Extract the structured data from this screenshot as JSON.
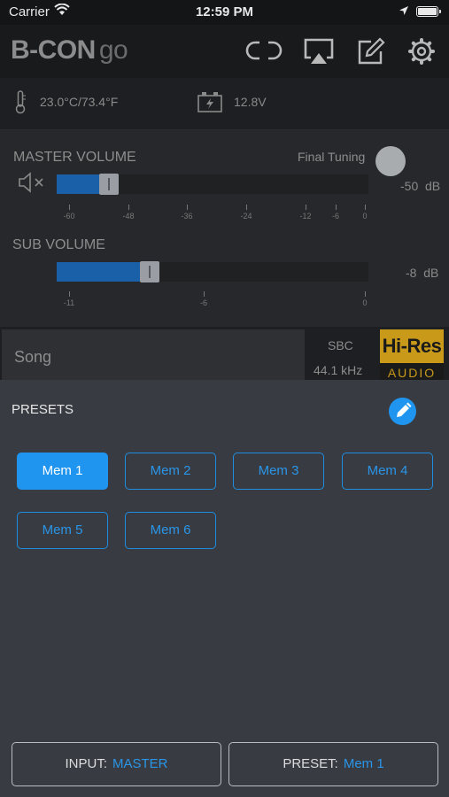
{
  "status_bar": {
    "carrier": "Carrier",
    "time": "12:59 PM"
  },
  "header": {
    "logo_main": "B-CON",
    "logo_sub": "go",
    "icons": [
      "link-icon",
      "airplay-icon",
      "edit-icon",
      "settings-gear-icon"
    ]
  },
  "info": {
    "temperature": "23.0°C/73.4°F",
    "voltage": "12.8V"
  },
  "master_volume": {
    "label": "MASTER VOLUME",
    "final_tuning_label": "Final Tuning",
    "value_db": "-50",
    "unit": "dB",
    "level": 0.2,
    "ticks": [
      "-60",
      "-48",
      "-36",
      "-24",
      "-12",
      "-6",
      "0"
    ]
  },
  "sub_volume": {
    "label": "SUB VOLUME",
    "value_db": "-8",
    "unit": "dB",
    "level": 0.33,
    "ticks": [
      "-11",
      "-6",
      "0"
    ]
  },
  "now_playing": {
    "song": "Song",
    "codec": "SBC",
    "sample_rate": "44.1 kHz",
    "badge_top": "Hi-Res",
    "badge_bottom": "AUDIO"
  },
  "presets": {
    "title": "PRESETS",
    "items": [
      {
        "label": "Mem 1",
        "active": true
      },
      {
        "label": "Mem 2",
        "active": false
      },
      {
        "label": "Mem 3",
        "active": false
      },
      {
        "label": "Mem 4",
        "active": false
      },
      {
        "label": "Mem 5",
        "active": false
      },
      {
        "label": "Mem 6",
        "active": false
      }
    ]
  },
  "footer": {
    "input_label": "INPUT:",
    "input_value": "MASTER",
    "preset_label": "PRESET:",
    "preset_value": "Mem 1"
  },
  "colors": {
    "accent": "#1f95f0",
    "panel": "#383c42",
    "slider_fill": "#1a60a8"
  }
}
